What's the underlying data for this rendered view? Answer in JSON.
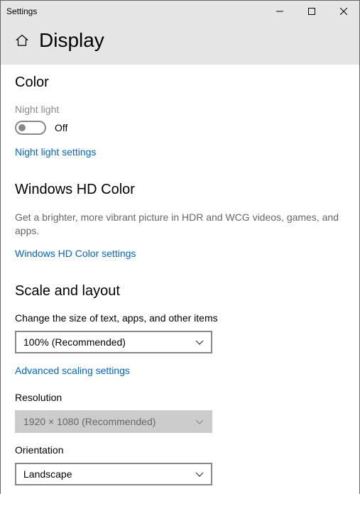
{
  "window": {
    "title": "Settings"
  },
  "header": {
    "title": "Display"
  },
  "color": {
    "title": "Color",
    "nightLightLabel": "Night light",
    "nightLightState": "Off",
    "nightLightSettingsLink": "Night light settings"
  },
  "hdColor": {
    "title": "Windows HD Color",
    "description": "Get a brighter, more vibrant picture in HDR and WCG videos, games, and apps.",
    "settingsLink": "Windows HD Color settings"
  },
  "scale": {
    "title": "Scale and layout",
    "sizeLabel": "Change the size of text, apps, and other items",
    "sizeValue": "100% (Recommended)",
    "advancedLink": "Advanced scaling settings",
    "resolutionLabel": "Resolution",
    "resolutionValue": "1920 × 1080 (Recommended)",
    "orientationLabel": "Orientation",
    "orientationValue": "Landscape"
  }
}
